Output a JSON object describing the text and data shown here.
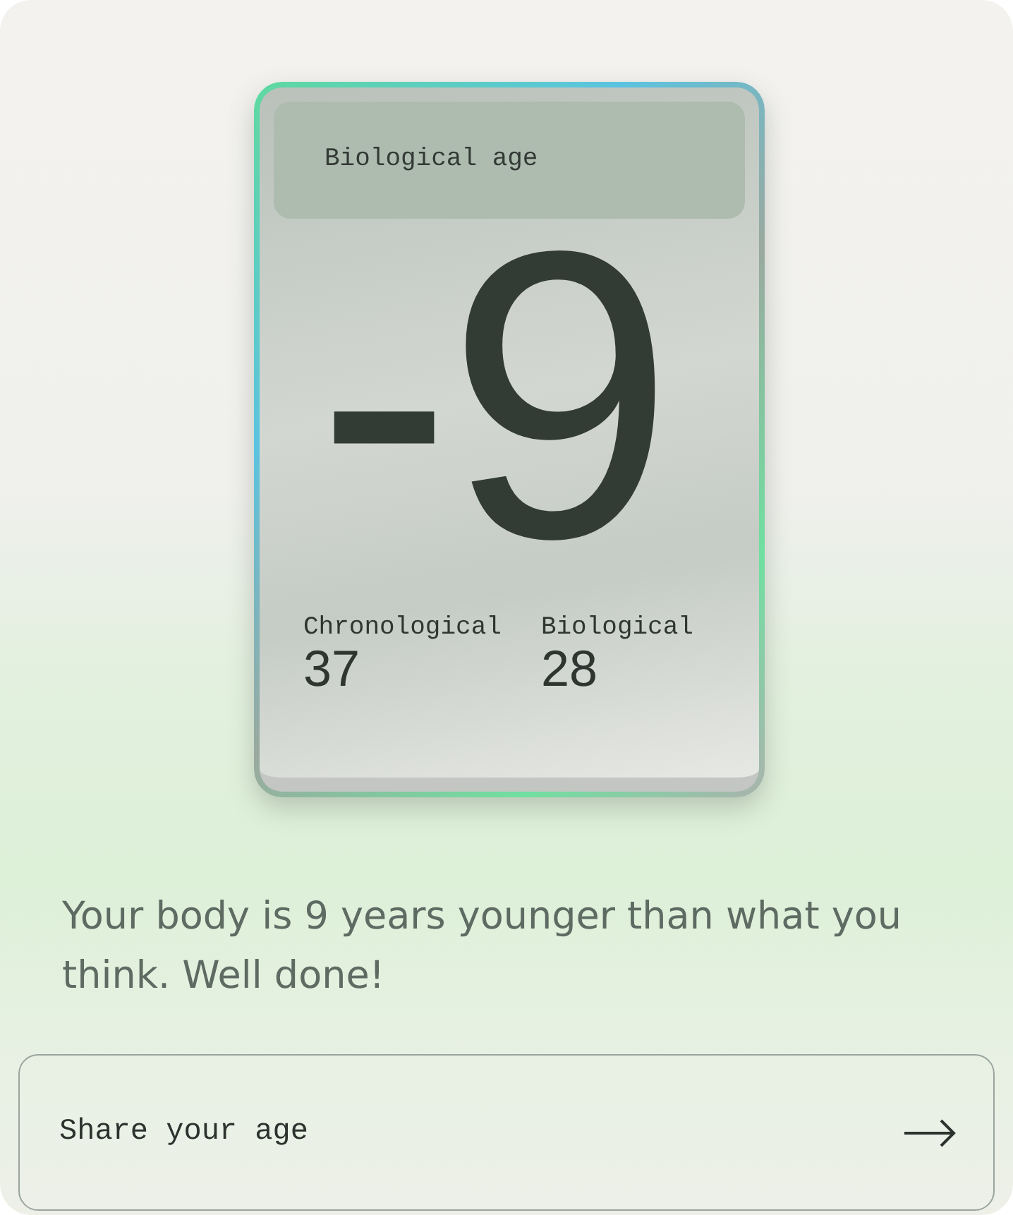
{
  "card": {
    "title": "Biological age",
    "value": "-9",
    "stats": [
      {
        "label": "Chronological",
        "value": "37"
      },
      {
        "label": "Biological",
        "value": "28"
      }
    ]
  },
  "message": "Your body is 9 years younger than what you think. Well done!",
  "share_button": {
    "label": "Share your age"
  }
}
